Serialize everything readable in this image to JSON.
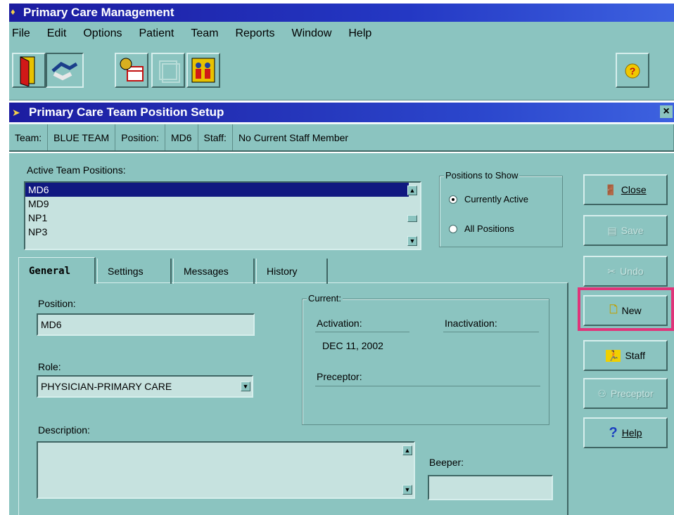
{
  "app": {
    "title": "Primary Care Management"
  },
  "menu": [
    "File",
    "Edit",
    "Options",
    "Patient",
    "Team",
    "Reports",
    "Window",
    "Help"
  ],
  "child_window": {
    "title": "Primary Care Team Position Setup",
    "close": "×"
  },
  "info_bar": {
    "team_label": "Team:",
    "team_value": "BLUE TEAM",
    "position_label": "Position:",
    "position_value": "MD6",
    "staff_label": "Staff:",
    "staff_value": "No Current Staff Member"
  },
  "positions_list": {
    "label": "Active Team Positions:",
    "items": [
      "MD6",
      "MD9",
      "NP1",
      "NP3"
    ],
    "selected": "MD6"
  },
  "positions_to_show": {
    "label": "Positions to Show",
    "options": [
      "Currently Active",
      "All Positions"
    ],
    "selected": "Currently Active"
  },
  "tabs": [
    "General",
    "Settings",
    "Messages",
    "History"
  ],
  "active_tab": "General",
  "general": {
    "position_label": "Position:",
    "position_value": "MD6",
    "role_label": "Role:",
    "role_value": "PHYSICIAN-PRIMARY CARE",
    "description_label": "Description:",
    "description_value": "",
    "beeper_label": "Beeper:",
    "beeper_value": "",
    "current_label": "Current:",
    "activation_label": "Activation:",
    "activation_value": "DEC 11, 2002",
    "inactivation_label": "Inactivation:",
    "preceptor_label": "Preceptor:"
  },
  "side_buttons": {
    "close": "Close",
    "save": "Save",
    "undo": "Undo",
    "new": "New",
    "staff": "Staff",
    "preceptor": "Preceptor",
    "help": "Help"
  },
  "colors": {
    "highlight": "#e0357a",
    "title_bar": "#1c1ca0",
    "window_bg": "#8bc4c0"
  }
}
